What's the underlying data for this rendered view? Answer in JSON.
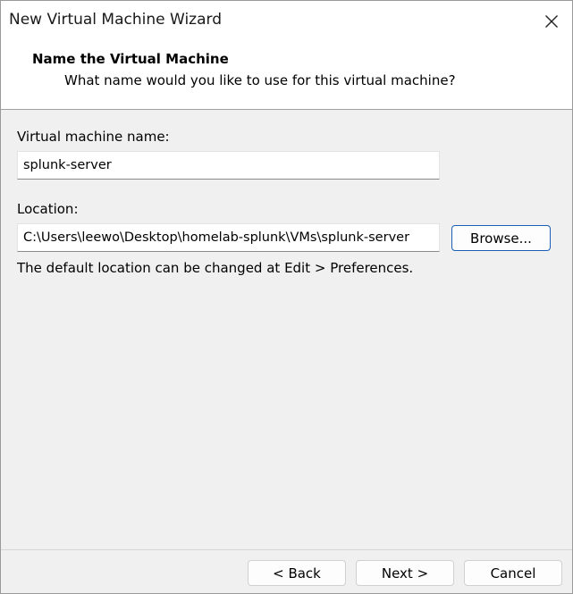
{
  "window": {
    "title": "New Virtual Machine Wizard"
  },
  "header": {
    "title": "Name the Virtual Machine",
    "subtitle": "What name would you like to use for this virtual machine?"
  },
  "form": {
    "vm_name_label": "Virtual machine name:",
    "vm_name_value": "splunk-server",
    "location_label": "Location:",
    "location_value": "C:\\Users\\leewo\\Desktop\\homelab-splunk\\VMs\\splunk-server",
    "browse_label": "Browse...",
    "hint": "The default location can be changed at Edit > Preferences."
  },
  "footer": {
    "back_label": "< Back",
    "next_label": "Next >",
    "cancel_label": "Cancel"
  },
  "icons": {
    "close": "close-icon"
  },
  "colors": {
    "accent": "#1b5fb4",
    "panel": "#f0f0f0",
    "header_bg": "#ffffff"
  }
}
